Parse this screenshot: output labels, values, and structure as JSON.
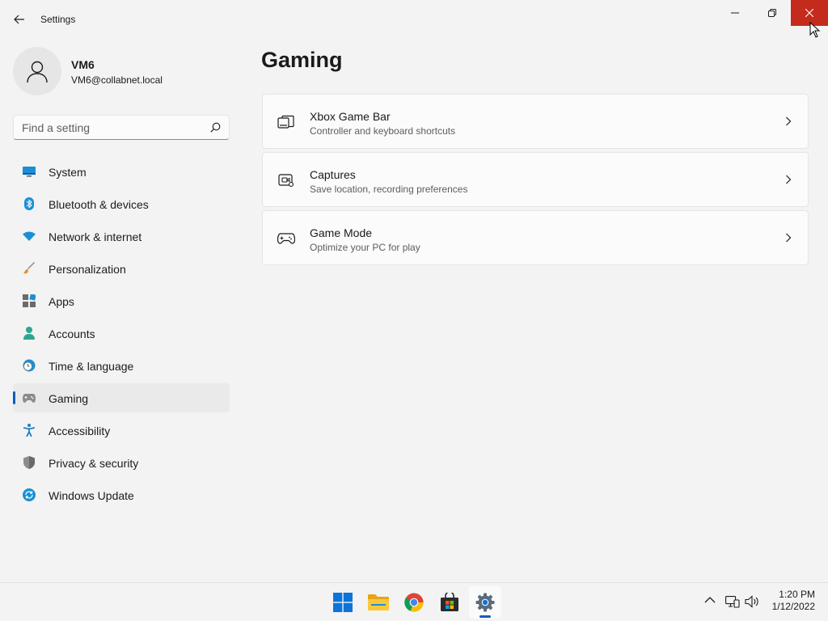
{
  "window": {
    "title": "Settings"
  },
  "user": {
    "name": "VM6",
    "email": "VM6@collabnet.local"
  },
  "search": {
    "placeholder": "Find a setting"
  },
  "nav": {
    "items": [
      {
        "label": "System",
        "icon": "system-icon"
      },
      {
        "label": "Bluetooth & devices",
        "icon": "bluetooth-icon"
      },
      {
        "label": "Network & internet",
        "icon": "wifi-icon"
      },
      {
        "label": "Personalization",
        "icon": "brush-icon"
      },
      {
        "label": "Apps",
        "icon": "apps-icon"
      },
      {
        "label": "Accounts",
        "icon": "accounts-icon"
      },
      {
        "label": "Time & language",
        "icon": "clock-globe-icon"
      },
      {
        "label": "Gaming",
        "icon": "gamepad-icon",
        "selected": true
      },
      {
        "label": "Accessibility",
        "icon": "accessibility-icon"
      },
      {
        "label": "Privacy & security",
        "icon": "shield-icon"
      },
      {
        "label": "Windows Update",
        "icon": "update-icon"
      }
    ]
  },
  "main": {
    "title": "Gaming",
    "cards": [
      {
        "title": "Xbox Game Bar",
        "subtitle": "Controller and keyboard shortcuts",
        "icon": "game-bar-icon"
      },
      {
        "title": "Captures",
        "subtitle": "Save location, recording preferences",
        "icon": "capture-icon"
      },
      {
        "title": "Game Mode",
        "subtitle": "Optimize your PC for play",
        "icon": "game-mode-icon"
      }
    ]
  },
  "taskbar": {
    "apps": [
      "start-icon",
      "file-explorer-icon",
      "chrome-icon",
      "store-icon",
      "settings-icon"
    ],
    "active_app": "settings-icon",
    "time": "1:20 PM",
    "date": "1/12/2022"
  },
  "colors": {
    "accent": "#005fb8",
    "close_hover": "#c42b1c",
    "background": "#f3f3f3",
    "card": "#fbfbfb"
  }
}
